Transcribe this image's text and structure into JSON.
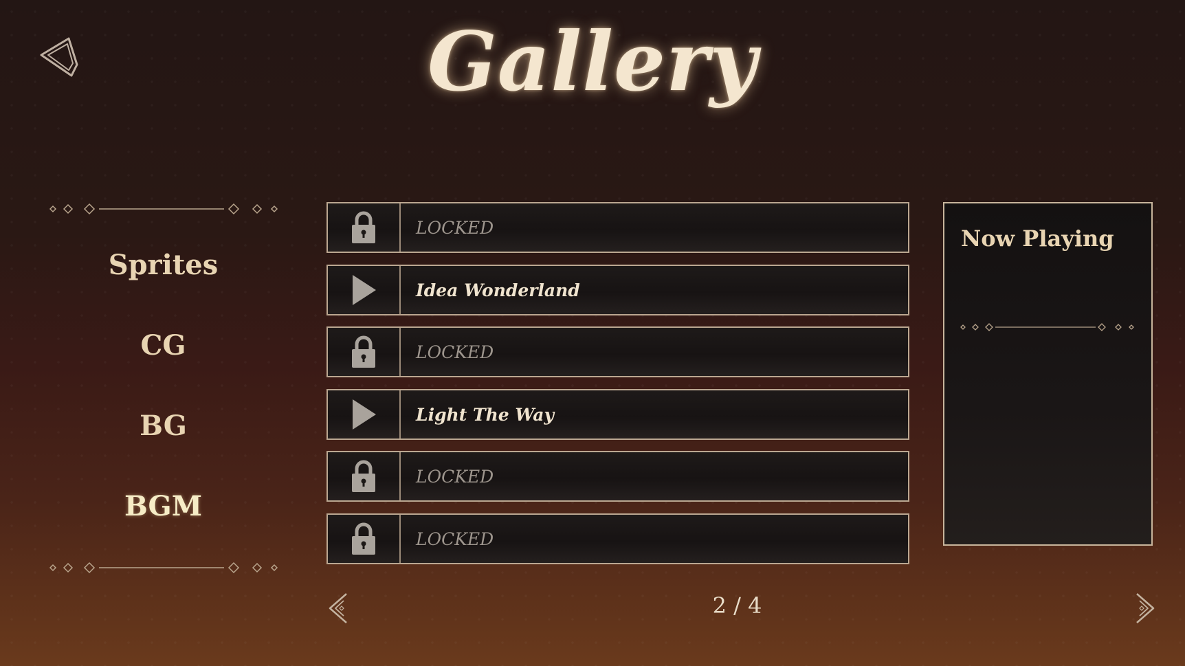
{
  "title": "Gallery",
  "nav": {
    "items": [
      {
        "label": "Sprites",
        "active": false
      },
      {
        "label": "CG",
        "active": false
      },
      {
        "label": "BG",
        "active": false
      },
      {
        "label": "BGM",
        "active": true
      }
    ]
  },
  "tracks": [
    {
      "label": "LOCKED",
      "icon": "lock-icon",
      "unlocked": false
    },
    {
      "label": "Idea Wonderland",
      "icon": "play-icon",
      "unlocked": true
    },
    {
      "label": "LOCKED",
      "icon": "lock-icon",
      "unlocked": false
    },
    {
      "label": "Light The Way",
      "icon": "play-icon",
      "unlocked": true
    },
    {
      "label": "LOCKED",
      "icon": "lock-icon",
      "unlocked": false
    },
    {
      "label": "LOCKED",
      "icon": "lock-icon",
      "unlocked": false
    }
  ],
  "now_playing": {
    "title": "Now Playing",
    "track": ""
  },
  "pagination": {
    "current": "2",
    "separator": "/",
    "total": "4",
    "text": "2 / 4"
  },
  "icons": {
    "back": "back-arrow-icon",
    "prev": "prev-page-icon",
    "next": "next-page-icon"
  },
  "colors": {
    "gold": "#e8d4b2",
    "active": "#f6ecc6",
    "locked_text": "#9d958d",
    "border": "#bba791"
  }
}
